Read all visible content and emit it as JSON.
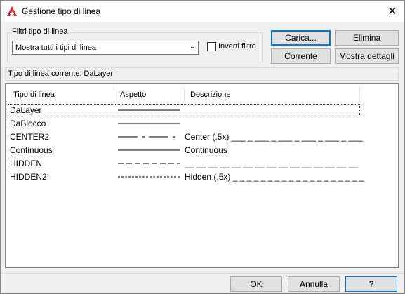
{
  "window": {
    "title": "Gestione tipo di linea"
  },
  "filters": {
    "group_label": "Filtri tipo di linea",
    "selected": "Mostra tutti i tipi di linea",
    "invert_label": "Inverti filtro"
  },
  "buttons": {
    "load": "Carica...",
    "delete": "Elimina",
    "current": "Corrente",
    "show_details": "Mostra dettagli"
  },
  "current_linetype": "Tipo di linea corrente:  DaLayer",
  "table": {
    "headers": [
      "Tipo di linea",
      "Aspetto",
      "Descrizione"
    ],
    "rows": [
      {
        "name": "DaLayer",
        "pattern": "solid",
        "description": ""
      },
      {
        "name": "DaBlocco",
        "pattern": "solid",
        "description": ""
      },
      {
        "name": "CENTER2",
        "pattern": "center",
        "description": "Center (.5x) ___ _ ___ _ ___ _ ___ _ ___ _ ___"
      },
      {
        "name": "Continuous",
        "pattern": "solid",
        "description": "Continuous"
      },
      {
        "name": "HIDDEN",
        "pattern": "hidden",
        "description": "__ __ __ __ __ __ __ __ __ __ __ __ __ __ __"
      },
      {
        "name": "HIDDEN2",
        "pattern": "hidden2",
        "description": "Hidden (.5x) _ _ _ _ _ _ _ _ _ _ _ _ _ _ _ _ _ _ _"
      }
    ]
  },
  "footer": {
    "ok": "OK",
    "cancel": "Annulla",
    "help": "?"
  }
}
